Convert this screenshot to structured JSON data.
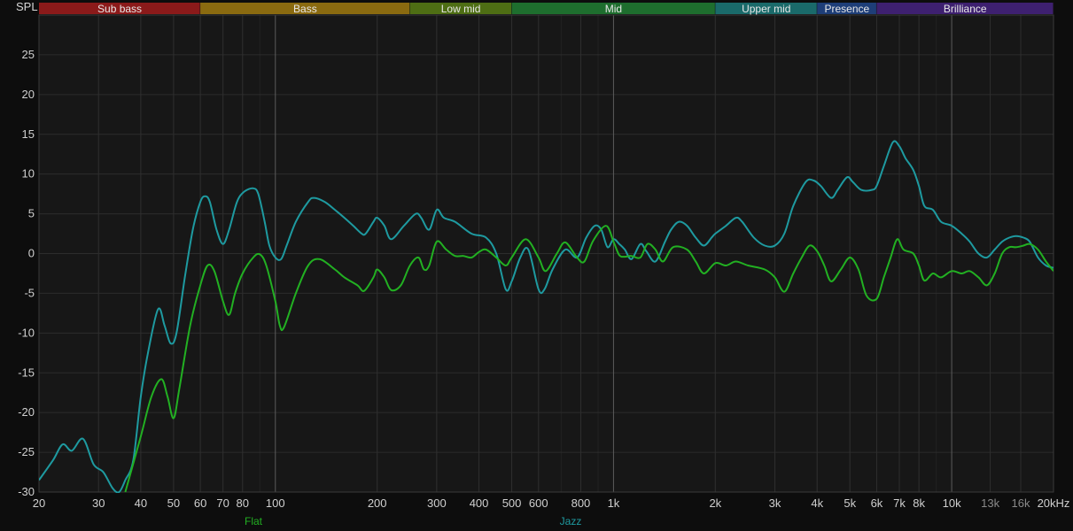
{
  "chart_data": {
    "type": "line",
    "ylabel": "SPL",
    "ylim": [
      -30,
      30
    ],
    "xlim": [
      20,
      20000
    ],
    "x_scale": "log",
    "grid": true,
    "yticks": [
      {
        "value": 25,
        "label": "25"
      },
      {
        "value": 20,
        "label": "20"
      },
      {
        "value": 15,
        "label": "15"
      },
      {
        "value": 10,
        "label": "10"
      },
      {
        "value": 5,
        "label": "5"
      },
      {
        "value": 0,
        "label": "0"
      },
      {
        "value": -5,
        "label": "-5"
      },
      {
        "value": -10,
        "label": "-10"
      },
      {
        "value": -15,
        "label": "-15"
      },
      {
        "value": -20,
        "label": "-20"
      },
      {
        "value": -25,
        "label": "-25"
      },
      {
        "value": -30,
        "label": "-30"
      }
    ],
    "xticks": [
      {
        "value": 20,
        "label": "20"
      },
      {
        "value": 30,
        "label": "30"
      },
      {
        "value": 40,
        "label": "40"
      },
      {
        "value": 50,
        "label": "50"
      },
      {
        "value": 60,
        "label": "60"
      },
      {
        "value": 70,
        "label": "70"
      },
      {
        "value": 80,
        "label": "80"
      },
      {
        "value": 100,
        "label": "100"
      },
      {
        "value": 200,
        "label": "200"
      },
      {
        "value": 300,
        "label": "300"
      },
      {
        "value": 400,
        "label": "400"
      },
      {
        "value": 500,
        "label": "500"
      },
      {
        "value": 600,
        "label": "600"
      },
      {
        "value": 800,
        "label": "800"
      },
      {
        "value": 1000,
        "label": "1k"
      },
      {
        "value": 2000,
        "label": "2k"
      },
      {
        "value": 3000,
        "label": "3k"
      },
      {
        "value": 4000,
        "label": "4k"
      },
      {
        "value": 5000,
        "label": "5k"
      },
      {
        "value": 6000,
        "label": "6k"
      },
      {
        "value": 7000,
        "label": "7k"
      },
      {
        "value": 8000,
        "label": "8k"
      },
      {
        "value": 10000,
        "label": "10k"
      },
      {
        "value": 13000,
        "label": "13k",
        "dim": true
      },
      {
        "value": 16000,
        "label": "16k",
        "dim": true
      },
      {
        "value": 20000,
        "label": "20kHz"
      }
    ],
    "bands": [
      {
        "name": "Sub bass",
        "from": 20,
        "to": 60,
        "color": "#8b1a1a"
      },
      {
        "name": "Bass",
        "from": 60,
        "to": 250,
        "color": "#8a6a10"
      },
      {
        "name": "Low mid",
        "from": 250,
        "to": 500,
        "color": "#4e6e14"
      },
      {
        "name": "Mid",
        "from": 500,
        "to": 2000,
        "color": "#1e6e2e"
      },
      {
        "name": "Upper mid",
        "from": 2000,
        "to": 4000,
        "color": "#1a6a6a"
      },
      {
        "name": "Presence",
        "from": 4000,
        "to": 6000,
        "color": "#1e3e78"
      },
      {
        "name": "Brilliance",
        "from": 6000,
        "to": 20000,
        "color": "#3e2070"
      }
    ],
    "series": [
      {
        "name": "Flat",
        "color": "#22b022",
        "points": [
          [
            36,
            -30
          ],
          [
            40,
            -23
          ],
          [
            43,
            -18
          ],
          [
            46,
            -15.8
          ],
          [
            48,
            -18
          ],
          [
            50,
            -20.7
          ],
          [
            52,
            -17
          ],
          [
            56,
            -9
          ],
          [
            60,
            -4
          ],
          [
            63,
            -1.5
          ],
          [
            66,
            -2.2
          ],
          [
            70,
            -6
          ],
          [
            73,
            -7.7
          ],
          [
            76,
            -5
          ],
          [
            80,
            -2.5
          ],
          [
            86,
            -0.5
          ],
          [
            90,
            -0.1
          ],
          [
            94,
            -1.5
          ],
          [
            100,
            -6
          ],
          [
            103,
            -9
          ],
          [
            106,
            -9.3
          ],
          [
            115,
            -5
          ],
          [
            125,
            -1.5
          ],
          [
            135,
            -0.7
          ],
          [
            150,
            -2
          ],
          [
            160,
            -3
          ],
          [
            175,
            -4
          ],
          [
            183,
            -4.7
          ],
          [
            195,
            -3
          ],
          [
            200,
            -2
          ],
          [
            210,
            -3
          ],
          [
            220,
            -4.6
          ],
          [
            235,
            -4
          ],
          [
            250,
            -1.5
          ],
          [
            265,
            -0.5
          ],
          [
            275,
            -2
          ],
          [
            285,
            -1.5
          ],
          [
            300,
            1.5
          ],
          [
            320,
            0.5
          ],
          [
            340,
            -0.3
          ],
          [
            360,
            -0.3
          ],
          [
            380,
            -0.5
          ],
          [
            400,
            0.2
          ],
          [
            420,
            0.5
          ],
          [
            450,
            -0.5
          ],
          [
            480,
            -1.5
          ],
          [
            500,
            -0.5
          ],
          [
            550,
            1.8
          ],
          [
            600,
            -0.5
          ],
          [
            630,
            -2.2
          ],
          [
            680,
            0
          ],
          [
            720,
            1.4
          ],
          [
            780,
            -0.5
          ],
          [
            820,
            -1
          ],
          [
            870,
            1.6
          ],
          [
            950,
            3.5
          ],
          [
            1000,
            1.5
          ],
          [
            1040,
            -0.2
          ],
          [
            1080,
            -0.4
          ],
          [
            1130,
            -0.3
          ],
          [
            1200,
            -0.5
          ],
          [
            1260,
            1.2
          ],
          [
            1330,
            0.5
          ],
          [
            1400,
            -1
          ],
          [
            1500,
            0.8
          ],
          [
            1650,
            0.5
          ],
          [
            1750,
            -1
          ],
          [
            1850,
            -2.5
          ],
          [
            2000,
            -1.2
          ],
          [
            2150,
            -1.5
          ],
          [
            2300,
            -1
          ],
          [
            2500,
            -1.5
          ],
          [
            2800,
            -2
          ],
          [
            3000,
            -3
          ],
          [
            3200,
            -4.8
          ],
          [
            3400,
            -2.5
          ],
          [
            3600,
            -0.5
          ],
          [
            3800,
            1
          ],
          [
            4000,
            0.3
          ],
          [
            4200,
            -1.5
          ],
          [
            4400,
            -3.5
          ],
          [
            4700,
            -2
          ],
          [
            5000,
            -0.5
          ],
          [
            5300,
            -2
          ],
          [
            5600,
            -5.3
          ],
          [
            6000,
            -5.7
          ],
          [
            6300,
            -3
          ],
          [
            6600,
            -0.5
          ],
          [
            6900,
            1.8
          ],
          [
            7200,
            0.5
          ],
          [
            7700,
            0
          ],
          [
            8000,
            -1.5
          ],
          [
            8300,
            -3.4
          ],
          [
            8800,
            -2.5
          ],
          [
            9300,
            -3
          ],
          [
            10000,
            -2.2
          ],
          [
            10700,
            -2.5
          ],
          [
            11300,
            -2.2
          ],
          [
            12000,
            -3
          ],
          [
            12700,
            -4
          ],
          [
            13400,
            -2.5
          ],
          [
            14100,
            0
          ],
          [
            14800,
            0.8
          ],
          [
            15500,
            0.8
          ],
          [
            16300,
            1
          ],
          [
            17000,
            1.2
          ],
          [
            18000,
            0.5
          ],
          [
            19000,
            -1
          ],
          [
            20000,
            -2.2
          ]
        ]
      },
      {
        "name": "Jazz",
        "color": "#1e9aa0",
        "points": [
          [
            20,
            -28.5
          ],
          [
            22,
            -26
          ],
          [
            23.5,
            -24
          ],
          [
            25,
            -24.8
          ],
          [
            27,
            -23.3
          ],
          [
            29,
            -26.5
          ],
          [
            31,
            -27.5
          ],
          [
            33,
            -29.5
          ],
          [
            34.5,
            -30
          ],
          [
            36,
            -28.5
          ],
          [
            38,
            -26
          ],
          [
            40,
            -18
          ],
          [
            42,
            -12.5
          ],
          [
            45,
            -7
          ],
          [
            47,
            -9
          ],
          [
            49,
            -11.3
          ],
          [
            51,
            -10
          ],
          [
            54,
            -3
          ],
          [
            57,
            3
          ],
          [
            60,
            6.5
          ],
          [
            62,
            7.2
          ],
          [
            64,
            6.5
          ],
          [
            67,
            3
          ],
          [
            70,
            1.2
          ],
          [
            73,
            3
          ],
          [
            77,
            6.5
          ],
          [
            81,
            7.8
          ],
          [
            86,
            8.2
          ],
          [
            89,
            7.5
          ],
          [
            93,
            4
          ],
          [
            96,
            1
          ],
          [
            100,
            -0.5
          ],
          [
            104,
            -0.7
          ],
          [
            108,
            1
          ],
          [
            115,
            4
          ],
          [
            125,
            6.5
          ],
          [
            130,
            7
          ],
          [
            140,
            6.5
          ],
          [
            150,
            5.5
          ],
          [
            160,
            4.5
          ],
          [
            170,
            3.5
          ],
          [
            180,
            2.5
          ],
          [
            185,
            2.5
          ],
          [
            195,
            4
          ],
          [
            200,
            4.5
          ],
          [
            210,
            3.5
          ],
          [
            220,
            1.8
          ],
          [
            240,
            3.5
          ],
          [
            260,
            5
          ],
          [
            270,
            4.5
          ],
          [
            285,
            3
          ],
          [
            300,
            5.5
          ],
          [
            315,
            4.5
          ],
          [
            340,
            4
          ],
          [
            380,
            2.5
          ],
          [
            420,
            2
          ],
          [
            450,
            0
          ],
          [
            480,
            -4.5
          ],
          [
            500,
            -3.5
          ],
          [
            530,
            -0.5
          ],
          [
            560,
            0.5
          ],
          [
            600,
            -4.5
          ],
          [
            625,
            -4.5
          ],
          [
            660,
            -2
          ],
          [
            720,
            0.5
          ],
          [
            780,
            -0.5
          ],
          [
            830,
            2
          ],
          [
            880,
            3.5
          ],
          [
            920,
            3
          ],
          [
            960,
            0.8
          ],
          [
            1000,
            1.8
          ],
          [
            1040,
            1.2
          ],
          [
            1080,
            0.5
          ],
          [
            1130,
            -0.7
          ],
          [
            1200,
            1.2
          ],
          [
            1250,
            0.3
          ],
          [
            1330,
            -1
          ],
          [
            1420,
            1.5
          ],
          [
            1480,
            3
          ],
          [
            1560,
            4
          ],
          [
            1650,
            3.5
          ],
          [
            1750,
            2
          ],
          [
            1850,
            1
          ],
          [
            1950,
            2
          ],
          [
            2000,
            2.5
          ],
          [
            2150,
            3.5
          ],
          [
            2300,
            4.5
          ],
          [
            2400,
            4
          ],
          [
            2600,
            2
          ],
          [
            2800,
            1
          ],
          [
            3000,
            1
          ],
          [
            3200,
            2.5
          ],
          [
            3400,
            6
          ],
          [
            3700,
            9
          ],
          [
            3900,
            9.2
          ],
          [
            4100,
            8.5
          ],
          [
            4400,
            7
          ],
          [
            4600,
            8
          ],
          [
            4900,
            9.6
          ],
          [
            5100,
            9
          ],
          [
            5400,
            8
          ],
          [
            5800,
            8
          ],
          [
            6000,
            8.5
          ],
          [
            6300,
            11
          ],
          [
            6700,
            14
          ],
          [
            7000,
            13.5
          ],
          [
            7300,
            12
          ],
          [
            7700,
            10.5
          ],
          [
            8000,
            8.5
          ],
          [
            8300,
            6
          ],
          [
            8800,
            5.5
          ],
          [
            9300,
            4
          ],
          [
            10000,
            3.5
          ],
          [
            10700,
            2.5
          ],
          [
            11300,
            1.5
          ],
          [
            12000,
            0
          ],
          [
            12700,
            -0.5
          ],
          [
            13400,
            0.5
          ],
          [
            14100,
            1.5
          ],
          [
            14800,
            2
          ],
          [
            15500,
            2.2
          ],
          [
            16300,
            2
          ],
          [
            17000,
            1.5
          ],
          [
            18000,
            -0.5
          ],
          [
            19000,
            -1.5
          ],
          [
            20000,
            -1.8
          ]
        ]
      }
    ]
  }
}
